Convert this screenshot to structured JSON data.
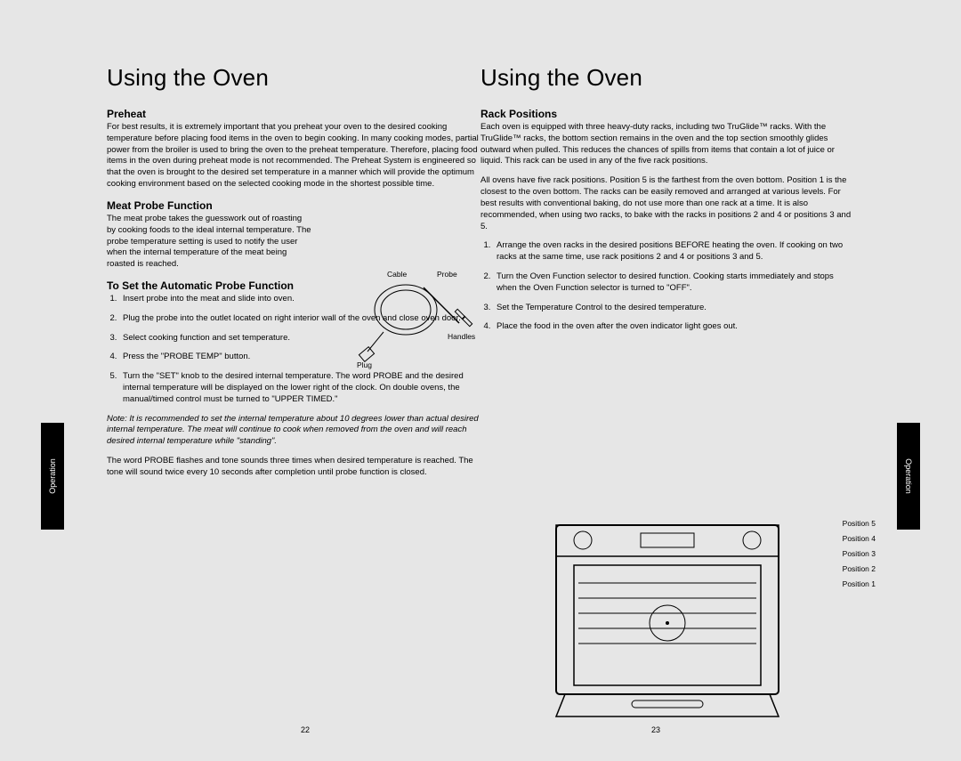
{
  "leftTitle": "Using the Oven",
  "rightTitle": "Using the Oven",
  "tabLabel": "Operation",
  "pageL": "22",
  "pageR": "23",
  "left": {
    "preheat": {
      "h": "Preheat",
      "p": "For best results, it is extremely important that you preheat your oven to the desired cooking temperature before placing food items in the oven to begin cooking. In many cooking modes, partial power from the broiler is used to bring the oven to the preheat temperature. Therefore, placing food items in the oven during preheat mode is not recommended. The Preheat System is engineered so that the oven is brought to the desired set temperature in a manner which will provide the optimum cooking environment based on the selected cooking mode in the shortest possible time."
    },
    "meat": {
      "h": "Meat Probe Function",
      "p": "The meat probe takes the guesswork out of roasting by cooking foods to the ideal internal temperature. The probe temperature setting is used to notify the user when the internal temperature of the meat being roasted is reached."
    },
    "set": {
      "h": "To Set the Automatic Probe Function",
      "li": [
        "Insert probe into the meat and slide into oven.",
        "Plug the probe into the outlet located on right interior wall of the oven and close oven door.",
        "Select cooking function and set temperature.",
        "Press the \"PROBE TEMP\" button.",
        "Turn the \"SET\" knob to the desired internal temperature. The word PROBE and the desired internal temperature will be displayed on the lower right of the clock. On double ovens, the manual/timed control must be turned to \"UPPER TIMED.\""
      ]
    },
    "note": "Note: It is recommended to set the internal temperature about 10 degrees lower than actual desired internal temperature. The meat will continue to cook when removed from the oven and will reach desired internal temperature while \"standing\".",
    "after": "The word PROBE flashes and tone sounds three times when desired temperature is reached. The tone will sound twice every 10 seconds after completion until probe function is closed."
  },
  "right": {
    "rack": {
      "h": "Rack Positions",
      "p1": "Each oven is equipped with three heavy-duty racks, including two TruGlide™ racks. With the TruGlide™ racks, the bottom section remains in the oven and the top section smoothly glides outward when pulled. This reduces the chances of spills from items that contain a lot of juice or liquid. This rack can be used in any of the five rack positions.",
      "p2": "All ovens have five rack positions. Position 5 is the farthest from the oven bottom. Position 1 is the closest to the oven bottom. The racks can be easily removed and arranged at various levels. For best results with conventional baking, do not use more than one rack at a time. It is also recommended, when using two racks, to bake with the racks in positions 2 and 4 or positions 3 and 5.",
      "li": [
        "Arrange the oven racks in the desired positions BEFORE heating the oven. If cooking on two racks at the same time, use rack positions 2 and 4 or positions 3 and 5.",
        "Turn the Oven Function selector to desired function. Cooking starts immediately and stops when the Oven Function selector is turned to \"OFF\".",
        "Set the Temperature Control to the desired temperature.",
        "Place the food in the oven after the oven indicator light goes out."
      ]
    },
    "positions": [
      "Position 5",
      "Position 4",
      "Position 3",
      "Position 2",
      "Position 1"
    ]
  },
  "fig": {
    "cable": "Cable",
    "probe": "Probe",
    "handles": "Handles",
    "plug": "Plug"
  }
}
